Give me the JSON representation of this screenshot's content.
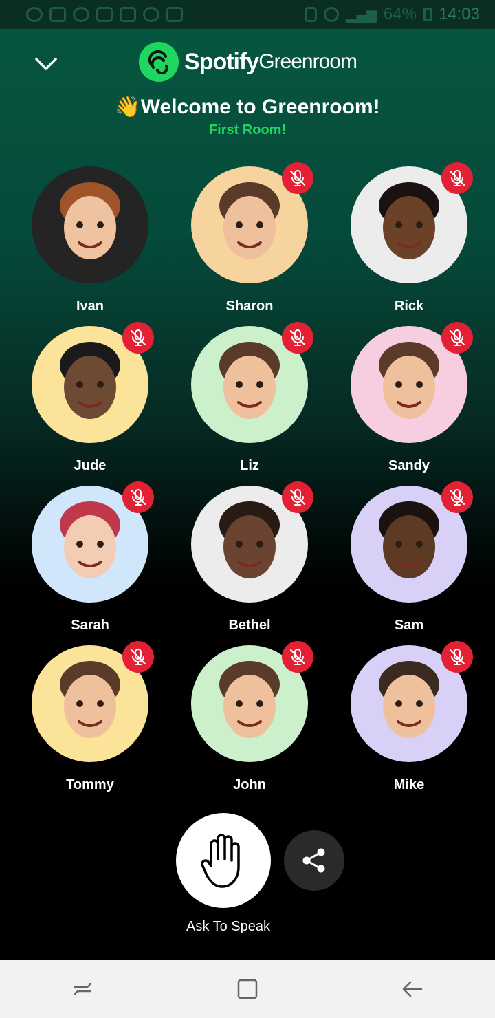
{
  "status_bar": {
    "battery": "64%",
    "time": "14:03",
    "icons": [
      "whatsapp-icon",
      "mail-icon",
      "reddit-icon",
      "gmail-icon",
      "linkedin-icon",
      "wifi-icon",
      "calendar-icon"
    ]
  },
  "app": {
    "logo": {
      "brand": "Spotify",
      "suffix": "Greenroom"
    },
    "welcome": "👋Welcome to Greenroom!",
    "room_name": "First Room!",
    "colors": {
      "accent": "#1ed760",
      "mute": "#e22134"
    }
  },
  "speakers": [
    {
      "name": "Ivan",
      "muted": false,
      "bg": "#242424",
      "skin": "#f0c3a0",
      "hair": "#a0542a"
    },
    {
      "name": "Sharon",
      "muted": true,
      "bg": "#f7d39e",
      "skin": "#efc09c",
      "hair": "#5a3a28"
    },
    {
      "name": "Rick",
      "muted": true,
      "bg": "#ececec",
      "skin": "#6b4128",
      "hair": "#1a1210"
    },
    {
      "name": "Jude",
      "muted": true,
      "bg": "#fce39a",
      "skin": "#6d4a33",
      "hair": "#1a1a1a"
    },
    {
      "name": "Liz",
      "muted": true,
      "bg": "#cbf0cb",
      "skin": "#efc09c",
      "hair": "#5a3a28"
    },
    {
      "name": "Sandy",
      "muted": true,
      "bg": "#f7cde0",
      "skin": "#efc09c",
      "hair": "#5a3a28"
    },
    {
      "name": "Sarah",
      "muted": true,
      "bg": "#cfe6fb",
      "skin": "#f3cdb3",
      "hair": "#c0394a"
    },
    {
      "name": "Bethel",
      "muted": true,
      "bg": "#ececec",
      "skin": "#6a4430",
      "hair": "#2a1a14"
    },
    {
      "name": "Sam",
      "muted": true,
      "bg": "#d9d0f7",
      "skin": "#5c3a24",
      "hair": "#1a1210"
    },
    {
      "name": "Tommy",
      "muted": true,
      "bg": "#fce39a",
      "skin": "#efc09c",
      "hair": "#5a3a28"
    },
    {
      "name": "John",
      "muted": true,
      "bg": "#cbf0cb",
      "skin": "#efc09c",
      "hair": "#5a3a28"
    },
    {
      "name": "Mike",
      "muted": true,
      "bg": "#d9d0f7",
      "skin": "#efc09c",
      "hair": "#3b2a20"
    }
  ],
  "actions": {
    "ask_to_speak": "Ask To Speak"
  },
  "nav": {
    "recent_icon": "recent-apps-icon",
    "home_icon": "home-icon",
    "back_icon": "back-icon"
  }
}
